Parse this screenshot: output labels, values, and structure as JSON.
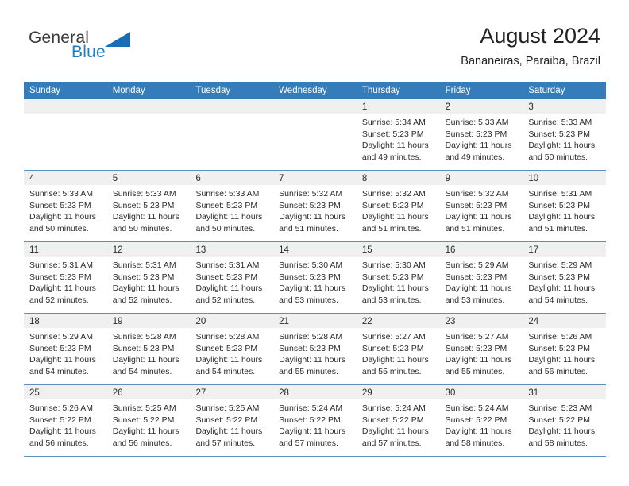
{
  "logo": {
    "word_top": "General",
    "word_bottom": "Blue",
    "triangle_color": "#1b6db3",
    "blue_color": "#1f7fc4",
    "icon": "triangle-icon"
  },
  "header": {
    "title": "August 2024",
    "subtitle": "Bananeiras, Paraiba, Brazil"
  },
  "calendar": {
    "accent_color": "#357cba",
    "row_divider_color": "#5b8fc0",
    "day_band_color": "#f0f0f0",
    "weekdays": [
      "Sunday",
      "Monday",
      "Tuesday",
      "Wednesday",
      "Thursday",
      "Friday",
      "Saturday"
    ],
    "weeks": [
      [
        {
          "date": "",
          "lines": []
        },
        {
          "date": "",
          "lines": []
        },
        {
          "date": "",
          "lines": []
        },
        {
          "date": "",
          "lines": []
        },
        {
          "date": "1",
          "lines": [
            "Sunrise: 5:34 AM",
            "Sunset: 5:23 PM",
            "Daylight: 11 hours",
            "and 49 minutes."
          ]
        },
        {
          "date": "2",
          "lines": [
            "Sunrise: 5:33 AM",
            "Sunset: 5:23 PM",
            "Daylight: 11 hours",
            "and 49 minutes."
          ]
        },
        {
          "date": "3",
          "lines": [
            "Sunrise: 5:33 AM",
            "Sunset: 5:23 PM",
            "Daylight: 11 hours",
            "and 50 minutes."
          ]
        }
      ],
      [
        {
          "date": "4",
          "lines": [
            "Sunrise: 5:33 AM",
            "Sunset: 5:23 PM",
            "Daylight: 11 hours",
            "and 50 minutes."
          ]
        },
        {
          "date": "5",
          "lines": [
            "Sunrise: 5:33 AM",
            "Sunset: 5:23 PM",
            "Daylight: 11 hours",
            "and 50 minutes."
          ]
        },
        {
          "date": "6",
          "lines": [
            "Sunrise: 5:33 AM",
            "Sunset: 5:23 PM",
            "Daylight: 11 hours",
            "and 50 minutes."
          ]
        },
        {
          "date": "7",
          "lines": [
            "Sunrise: 5:32 AM",
            "Sunset: 5:23 PM",
            "Daylight: 11 hours",
            "and 51 minutes."
          ]
        },
        {
          "date": "8",
          "lines": [
            "Sunrise: 5:32 AM",
            "Sunset: 5:23 PM",
            "Daylight: 11 hours",
            "and 51 minutes."
          ]
        },
        {
          "date": "9",
          "lines": [
            "Sunrise: 5:32 AM",
            "Sunset: 5:23 PM",
            "Daylight: 11 hours",
            "and 51 minutes."
          ]
        },
        {
          "date": "10",
          "lines": [
            "Sunrise: 5:31 AM",
            "Sunset: 5:23 PM",
            "Daylight: 11 hours",
            "and 51 minutes."
          ]
        }
      ],
      [
        {
          "date": "11",
          "lines": [
            "Sunrise: 5:31 AM",
            "Sunset: 5:23 PM",
            "Daylight: 11 hours",
            "and 52 minutes."
          ]
        },
        {
          "date": "12",
          "lines": [
            "Sunrise: 5:31 AM",
            "Sunset: 5:23 PM",
            "Daylight: 11 hours",
            "and 52 minutes."
          ]
        },
        {
          "date": "13",
          "lines": [
            "Sunrise: 5:31 AM",
            "Sunset: 5:23 PM",
            "Daylight: 11 hours",
            "and 52 minutes."
          ]
        },
        {
          "date": "14",
          "lines": [
            "Sunrise: 5:30 AM",
            "Sunset: 5:23 PM",
            "Daylight: 11 hours",
            "and 53 minutes."
          ]
        },
        {
          "date": "15",
          "lines": [
            "Sunrise: 5:30 AM",
            "Sunset: 5:23 PM",
            "Daylight: 11 hours",
            "and 53 minutes."
          ]
        },
        {
          "date": "16",
          "lines": [
            "Sunrise: 5:29 AM",
            "Sunset: 5:23 PM",
            "Daylight: 11 hours",
            "and 53 minutes."
          ]
        },
        {
          "date": "17",
          "lines": [
            "Sunrise: 5:29 AM",
            "Sunset: 5:23 PM",
            "Daylight: 11 hours",
            "and 54 minutes."
          ]
        }
      ],
      [
        {
          "date": "18",
          "lines": [
            "Sunrise: 5:29 AM",
            "Sunset: 5:23 PM",
            "Daylight: 11 hours",
            "and 54 minutes."
          ]
        },
        {
          "date": "19",
          "lines": [
            "Sunrise: 5:28 AM",
            "Sunset: 5:23 PM",
            "Daylight: 11 hours",
            "and 54 minutes."
          ]
        },
        {
          "date": "20",
          "lines": [
            "Sunrise: 5:28 AM",
            "Sunset: 5:23 PM",
            "Daylight: 11 hours",
            "and 54 minutes."
          ]
        },
        {
          "date": "21",
          "lines": [
            "Sunrise: 5:28 AM",
            "Sunset: 5:23 PM",
            "Daylight: 11 hours",
            "and 55 minutes."
          ]
        },
        {
          "date": "22",
          "lines": [
            "Sunrise: 5:27 AM",
            "Sunset: 5:23 PM",
            "Daylight: 11 hours",
            "and 55 minutes."
          ]
        },
        {
          "date": "23",
          "lines": [
            "Sunrise: 5:27 AM",
            "Sunset: 5:23 PM",
            "Daylight: 11 hours",
            "and 55 minutes."
          ]
        },
        {
          "date": "24",
          "lines": [
            "Sunrise: 5:26 AM",
            "Sunset: 5:23 PM",
            "Daylight: 11 hours",
            "and 56 minutes."
          ]
        }
      ],
      [
        {
          "date": "25",
          "lines": [
            "Sunrise: 5:26 AM",
            "Sunset: 5:22 PM",
            "Daylight: 11 hours",
            "and 56 minutes."
          ]
        },
        {
          "date": "26",
          "lines": [
            "Sunrise: 5:25 AM",
            "Sunset: 5:22 PM",
            "Daylight: 11 hours",
            "and 56 minutes."
          ]
        },
        {
          "date": "27",
          "lines": [
            "Sunrise: 5:25 AM",
            "Sunset: 5:22 PM",
            "Daylight: 11 hours",
            "and 57 minutes."
          ]
        },
        {
          "date": "28",
          "lines": [
            "Sunrise: 5:24 AM",
            "Sunset: 5:22 PM",
            "Daylight: 11 hours",
            "and 57 minutes."
          ]
        },
        {
          "date": "29",
          "lines": [
            "Sunrise: 5:24 AM",
            "Sunset: 5:22 PM",
            "Daylight: 11 hours",
            "and 57 minutes."
          ]
        },
        {
          "date": "30",
          "lines": [
            "Sunrise: 5:24 AM",
            "Sunset: 5:22 PM",
            "Daylight: 11 hours",
            "and 58 minutes."
          ]
        },
        {
          "date": "31",
          "lines": [
            "Sunrise: 5:23 AM",
            "Sunset: 5:22 PM",
            "Daylight: 11 hours",
            "and 58 minutes."
          ]
        }
      ]
    ]
  }
}
